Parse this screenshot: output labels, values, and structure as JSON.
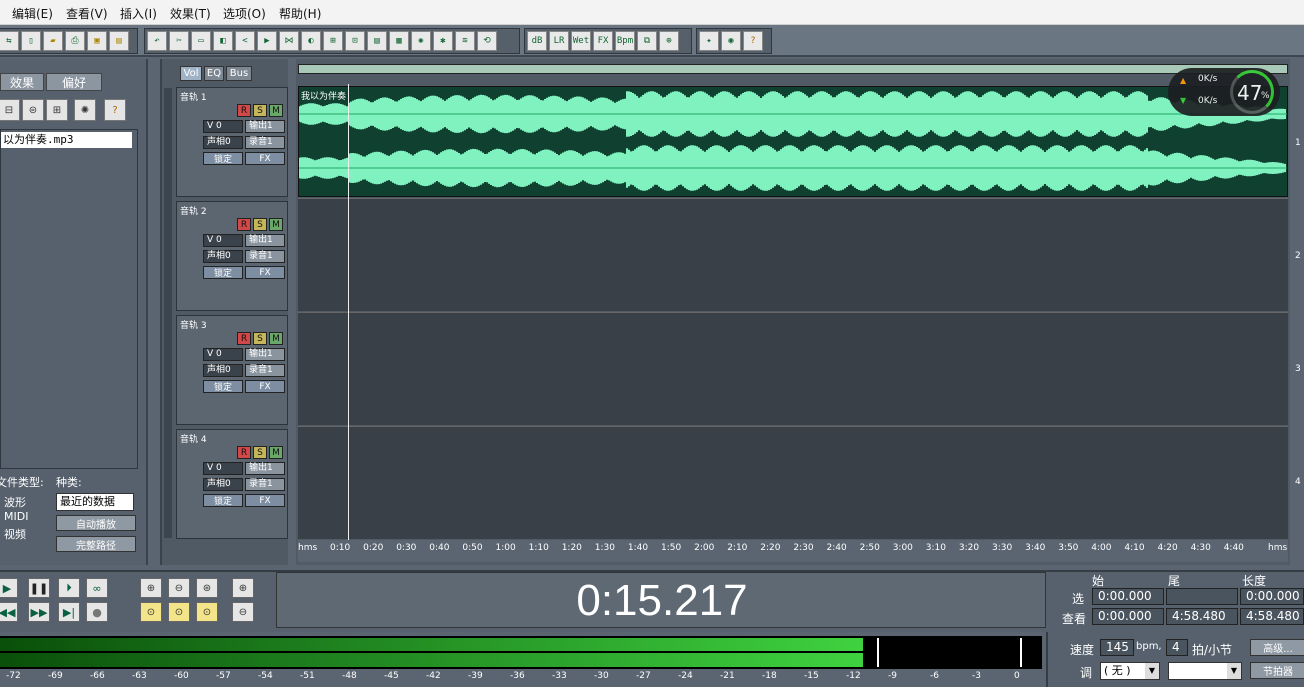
{
  "menu": [
    "编辑(E)",
    "查看(V)",
    "插入(I)",
    "效果(T)",
    "选项(O)",
    "帮助(H)"
  ],
  "toolbar_icons": [
    "switch-view",
    "new",
    "open",
    "print",
    "save",
    "save-all",
    "undo",
    "cut-tool",
    "select",
    "envelope",
    "hybrid",
    "snap",
    "mix",
    "mute",
    "insert",
    "loop",
    "copy",
    "mark",
    "marker",
    "wave",
    "split",
    "trim",
    "bounce",
    "vol",
    "wet",
    "fx",
    "bpm",
    "sync",
    "insert-file",
    "cd-burn",
    "help"
  ],
  "left": {
    "tabs": [
      "效果",
      "偏好"
    ],
    "file": "以为伴奏.mp3",
    "file_type_label": "文件类型:",
    "kind_label": "种类:",
    "types": [
      "波形",
      "MIDI",
      "视频"
    ],
    "kind_value": "最近的数据",
    "autoplay": "自动播放",
    "fullpath": "完整路径"
  },
  "tracks_header": {
    "tabs": [
      "Vol",
      "EQ",
      "Bus"
    ],
    "tracks": [
      {
        "name": "音轨 1",
        "vol": "V 0",
        "pan": "声相0",
        "out": "输出1",
        "rec": "录音1",
        "lock": "锁定",
        "fx": "FX"
      },
      {
        "name": "音轨 2",
        "vol": "V 0",
        "pan": "声相0",
        "out": "输出1",
        "rec": "录音1",
        "lock": "锁定",
        "fx": "FX"
      },
      {
        "name": "音轨 3",
        "vol": "V 0",
        "pan": "声相0",
        "out": "输出1",
        "rec": "录音1",
        "lock": "锁定",
        "fx": "FX"
      },
      {
        "name": "音轨 4",
        "vol": "V 0",
        "pan": "声相0",
        "out": "输出1",
        "rec": "录音1",
        "lock": "锁定",
        "fx": "FX"
      }
    ],
    "rsm": [
      "R",
      "S",
      "M"
    ]
  },
  "wave": {
    "clip_name": "我以为伴奏",
    "ruler": [
      "hms",
      "0:10",
      "0:20",
      "0:30",
      "0:40",
      "0:50",
      "1:00",
      "1:10",
      "1:20",
      "1:30",
      "1:40",
      "1:50",
      "2:00",
      "2:10",
      "2:20",
      "2:30",
      "2:40",
      "2:50",
      "3:00",
      "3:10",
      "3:20",
      "3:30",
      "3:40",
      "3:50",
      "4:00",
      "4:10",
      "4:20",
      "4:30",
      "4:40",
      "hms"
    ],
    "row_labels": [
      "1",
      "2",
      "3",
      "4"
    ]
  },
  "net": {
    "up": "0K/s",
    "down": "0K/s",
    "percent": "47",
    "unit": "%"
  },
  "time": "0:15.217",
  "selection": {
    "headers": [
      "始",
      "尾",
      "长度"
    ],
    "rows": [
      {
        "label": "选",
        "start": "0:00.000",
        "end": "",
        "len": "0:00.000"
      },
      {
        "label": "查看",
        "start": "0:00.000",
        "end": "4:58.480",
        "len": "4:58.480"
      }
    ]
  },
  "meter": {
    "labels": [
      "-72",
      "-69",
      "-66",
      "-63",
      "-60",
      "-57",
      "-54",
      "-51",
      "-48",
      "-45",
      "-42",
      "-39",
      "-36",
      "-33",
      "-30",
      "-27",
      "-24",
      "-21",
      "-18",
      "-15",
      "-12",
      "-9",
      "-6",
      "-3",
      "0"
    ],
    "level": 0.83
  },
  "tempo": {
    "label": "速度",
    "bpm": "145",
    "bpm_unit": "bpm,",
    "beats": "4",
    "beats_unit": "拍/小节",
    "advanced": "高级...",
    "key_label": "调",
    "key_value": "( 无 )",
    "metronome": "节拍器"
  }
}
